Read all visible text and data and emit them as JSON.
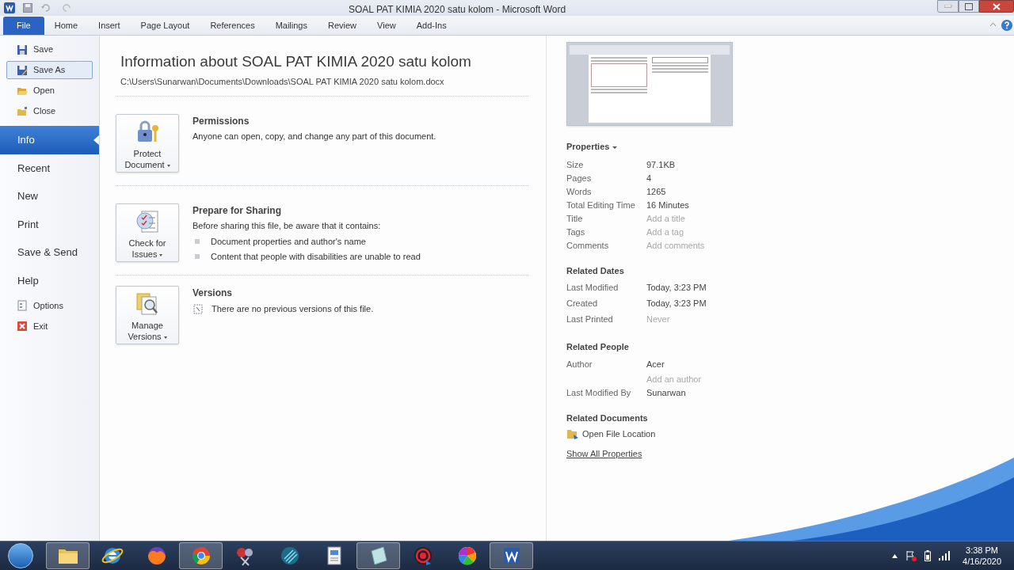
{
  "title_bar": {
    "title": "SOAL PAT KIMIA 2020 satu kolom - Microsoft Word"
  },
  "ribbon_tabs": [
    {
      "label": "File",
      "selected": true
    },
    {
      "label": "Home",
      "selected": false
    },
    {
      "label": "Insert",
      "selected": false
    },
    {
      "label": "Page Layout",
      "selected": false
    },
    {
      "label": "References",
      "selected": false
    },
    {
      "label": "Mailings",
      "selected": false
    },
    {
      "label": "Review",
      "selected": false
    },
    {
      "label": "View",
      "selected": false
    },
    {
      "label": "Add-Ins",
      "selected": false
    }
  ],
  "file_menu": [
    {
      "label": "Save",
      "kind": "save",
      "selected": false,
      "hovered": false
    },
    {
      "label": "Save As",
      "kind": "save_as",
      "selected": false,
      "hovered": true
    },
    {
      "label": "Open",
      "kind": "open",
      "selected": false,
      "hovered": false
    },
    {
      "label": "Close",
      "kind": "close",
      "selected": false,
      "hovered": false
    },
    {
      "label": "Info",
      "kind": "page",
      "selected": true,
      "hovered": false
    },
    {
      "label": "Recent",
      "kind": "page",
      "selected": false,
      "hovered": false
    },
    {
      "label": "New",
      "kind": "page",
      "selected": false,
      "hovered": false
    },
    {
      "label": "Print",
      "kind": "page",
      "selected": false,
      "hovered": false
    },
    {
      "label": "Save & Send",
      "kind": "page",
      "selected": false,
      "hovered": false
    },
    {
      "label": "Help",
      "kind": "page",
      "selected": false,
      "hovered": false
    },
    {
      "label": "Options",
      "kind": "options",
      "selected": false,
      "hovered": false
    },
    {
      "label": "Exit",
      "kind": "exit",
      "selected": false,
      "hovered": false
    }
  ],
  "info": {
    "heading": "Information about SOAL PAT KIMIA 2020 satu kolom",
    "path": "C:\\Users\\Sunarwan\\Documents\\Downloads\\SOAL PAT KIMIA 2020 satu kolom.docx",
    "sections": [
      {
        "button_lines": [
          "Protect",
          "Document"
        ],
        "title": "Permissions",
        "text": "Anyone can open, copy, and change any part of this document."
      },
      {
        "button_lines": [
          "Check for",
          "Issues"
        ],
        "title": "Prepare for Sharing",
        "text": "Before sharing this file, be aware that it contains:",
        "bullets": [
          "Document properties and author's name",
          "Content that people with disabilities are unable to read"
        ]
      },
      {
        "button_lines": [
          "Manage",
          "Versions"
        ],
        "title": "Versions",
        "note": "There are no previous versions of this file."
      }
    ]
  },
  "properties": {
    "heading": "Properties",
    "rows": [
      {
        "label": "Size",
        "values": [
          {
            "text": "97.1KB",
            "empty": false
          }
        ]
      },
      {
        "label": "Pages",
        "values": [
          {
            "text": "4",
            "empty": false
          }
        ]
      },
      {
        "label": "Words",
        "values": [
          {
            "text": "1265",
            "empty": false
          }
        ]
      },
      {
        "label": "Total Editing Time",
        "values": [
          {
            "text": "16 Minutes",
            "empty": false
          }
        ]
      },
      {
        "label": "Title",
        "values": [
          {
            "text": "Add a title",
            "empty": true
          }
        ]
      },
      {
        "label": "Tags",
        "values": [
          {
            "text": "Add a tag",
            "empty": true
          }
        ]
      },
      {
        "label": "Comments",
        "values": [
          {
            "text": "Add comments",
            "empty": true
          }
        ]
      }
    ],
    "groups": [
      {
        "heading": "Related Dates",
        "rows": [
          {
            "label": "Last Modified",
            "values": [
              {
                "text": "Today, 3:23 PM",
                "empty": false
              }
            ]
          },
          {
            "label": "Created",
            "values": [
              {
                "text": "Today, 3:23 PM",
                "empty": false
              }
            ]
          },
          {
            "label": "Last Printed",
            "values": [
              {
                "text": "Never",
                "empty": true
              }
            ]
          }
        ]
      },
      {
        "heading": "Related People",
        "rows": [
          {
            "label": "Author",
            "values": [
              {
                "text": "Acer",
                "empty": false
              },
              {
                "text": "Add an author",
                "empty": true
              }
            ]
          },
          {
            "label": "Last Modified By",
            "values": [
              {
                "text": "Sunarwan",
                "empty": false
              }
            ]
          }
        ]
      }
    ],
    "related_documents": {
      "heading": "Related Documents",
      "link": "Open File Location"
    },
    "show_all": "Show All Properties"
  },
  "taskbar": {
    "apps": [
      {
        "kind": "folder",
        "running": true
      },
      {
        "kind": "ie",
        "running": false
      },
      {
        "kind": "firefox",
        "running": false
      },
      {
        "kind": "chrome",
        "running": true
      },
      {
        "kind": "scissors",
        "running": false
      },
      {
        "kind": "disc",
        "running": false
      },
      {
        "kind": "document",
        "running": false
      },
      {
        "kind": "notes",
        "running": true
      },
      {
        "kind": "record",
        "running": false
      },
      {
        "kind": "pinwheel",
        "running": false
      },
      {
        "kind": "word",
        "running": true
      }
    ],
    "time": "3:38 PM",
    "date": "4/16/2020"
  }
}
